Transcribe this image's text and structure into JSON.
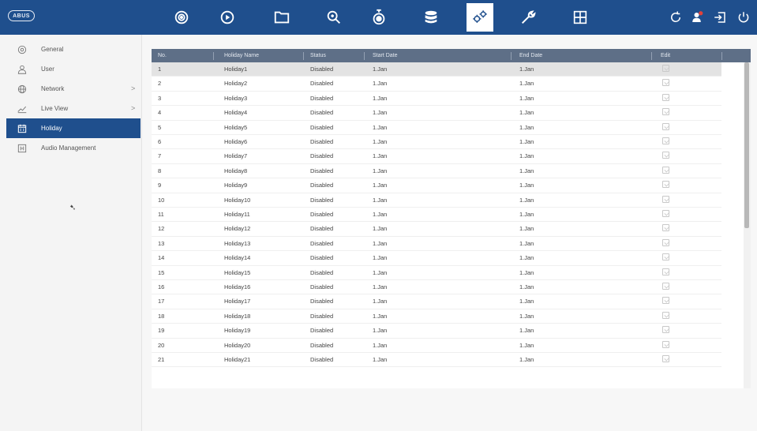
{
  "header": {
    "logo": "ABUS",
    "icons": [
      "camera-icon",
      "playback-icon",
      "folder-icon",
      "search-icon",
      "alarm-icon",
      "storage-icon",
      "system-settings-icon",
      "maintenance-icon",
      "layout-grid-icon"
    ],
    "active_icon": "system-settings-icon",
    "right_icons": [
      "refresh-icon",
      "user-alert-icon",
      "logout-icon",
      "power-icon"
    ],
    "colors": {
      "bar": "#1f4f8d",
      "active_bg": "#ffffff"
    }
  },
  "sidebar": {
    "items": [
      {
        "label": "General",
        "icon": "gear-icon",
        "has_arrow": false,
        "active": false
      },
      {
        "label": "User",
        "icon": "user-icon",
        "has_arrow": false,
        "active": false
      },
      {
        "label": "Network",
        "icon": "globe-icon",
        "has_arrow": true,
        "active": false
      },
      {
        "label": "Live View",
        "icon": "live-view-icon",
        "has_arrow": true,
        "active": false
      },
      {
        "label": "Holiday",
        "icon": "calendar-icon",
        "has_arrow": false,
        "active": true
      },
      {
        "label": "Audio Management",
        "icon": "audio-icon",
        "has_arrow": false,
        "active": false
      }
    ],
    "arrow": ">"
  },
  "table": {
    "columns": [
      "No.",
      "Holiday Name",
      "Status",
      "Start Date",
      "End Date",
      "Edit"
    ],
    "rows": [
      {
        "no": "1",
        "name": "Holiday1",
        "status": "Disabled",
        "start": "1.Jan",
        "end": "1.Jan"
      },
      {
        "no": "2",
        "name": "Holiday2",
        "status": "Disabled",
        "start": "1.Jan",
        "end": "1.Jan"
      },
      {
        "no": "3",
        "name": "Holiday3",
        "status": "Disabled",
        "start": "1.Jan",
        "end": "1.Jan"
      },
      {
        "no": "4",
        "name": "Holiday4",
        "status": "Disabled",
        "start": "1.Jan",
        "end": "1.Jan"
      },
      {
        "no": "5",
        "name": "Holiday5",
        "status": "Disabled",
        "start": "1.Jan",
        "end": "1.Jan"
      },
      {
        "no": "6",
        "name": "Holiday6",
        "status": "Disabled",
        "start": "1.Jan",
        "end": "1.Jan"
      },
      {
        "no": "7",
        "name": "Holiday7",
        "status": "Disabled",
        "start": "1.Jan",
        "end": "1.Jan"
      },
      {
        "no": "8",
        "name": "Holiday8",
        "status": "Disabled",
        "start": "1.Jan",
        "end": "1.Jan"
      },
      {
        "no": "9",
        "name": "Holiday9",
        "status": "Disabled",
        "start": "1.Jan",
        "end": "1.Jan"
      },
      {
        "no": "10",
        "name": "Holiday10",
        "status": "Disabled",
        "start": "1.Jan",
        "end": "1.Jan"
      },
      {
        "no": "11",
        "name": "Holiday11",
        "status": "Disabled",
        "start": "1.Jan",
        "end": "1.Jan"
      },
      {
        "no": "12",
        "name": "Holiday12",
        "status": "Disabled",
        "start": "1.Jan",
        "end": "1.Jan"
      },
      {
        "no": "13",
        "name": "Holiday13",
        "status": "Disabled",
        "start": "1.Jan",
        "end": "1.Jan"
      },
      {
        "no": "14",
        "name": "Holiday14",
        "status": "Disabled",
        "start": "1.Jan",
        "end": "1.Jan"
      },
      {
        "no": "15",
        "name": "Holiday15",
        "status": "Disabled",
        "start": "1.Jan",
        "end": "1.Jan"
      },
      {
        "no": "16",
        "name": "Holiday16",
        "status": "Disabled",
        "start": "1.Jan",
        "end": "1.Jan"
      },
      {
        "no": "17",
        "name": "Holiday17",
        "status": "Disabled",
        "start": "1.Jan",
        "end": "1.Jan"
      },
      {
        "no": "18",
        "name": "Holiday18",
        "status": "Disabled",
        "start": "1.Jan",
        "end": "1.Jan"
      },
      {
        "no": "19",
        "name": "Holiday19",
        "status": "Disabled",
        "start": "1.Jan",
        "end": "1.Jan"
      },
      {
        "no": "20",
        "name": "Holiday20",
        "status": "Disabled",
        "start": "1.Jan",
        "end": "1.Jan"
      },
      {
        "no": "21",
        "name": "Holiday21",
        "status": "Disabled",
        "start": "1.Jan",
        "end": "1.Jan"
      }
    ],
    "selected_row": 0,
    "colors": {
      "header_bg": "#5e6f87",
      "selected_row": "#e3e3e3"
    }
  }
}
